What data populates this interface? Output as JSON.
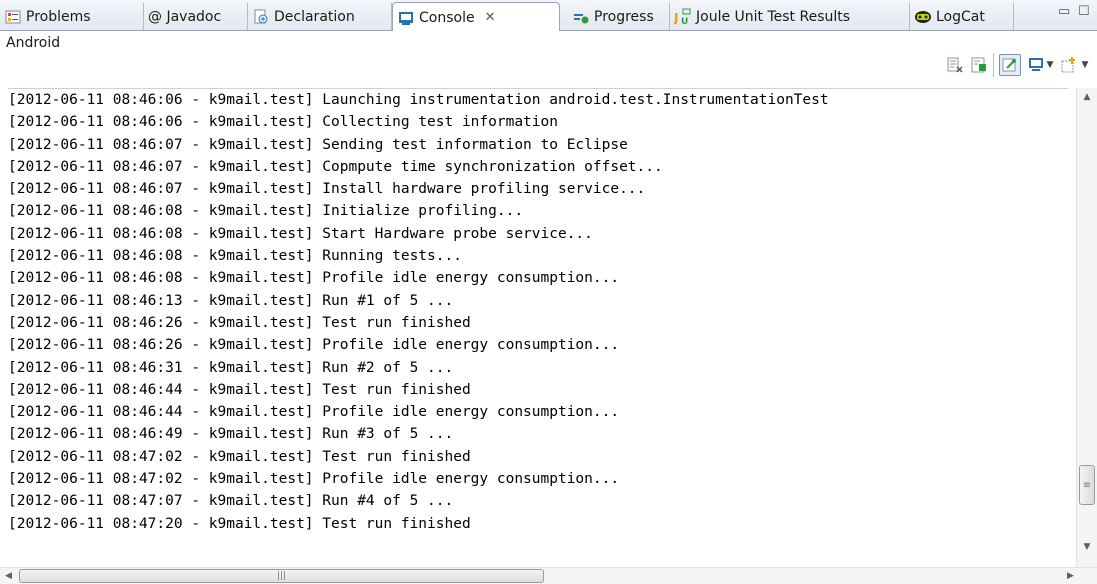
{
  "tabs": [
    {
      "label": "Problems",
      "icon": "problems-icon"
    },
    {
      "label": "@ Javadoc",
      "icon": ""
    },
    {
      "label": "Declaration",
      "icon": "declaration-icon"
    },
    {
      "label": "Console",
      "icon": "console-icon",
      "active": true,
      "close": "✕"
    },
    {
      "label": "Progress",
      "icon": "progress-icon"
    },
    {
      "label": "Joule Unit Test Results",
      "icon": "joule-icon"
    },
    {
      "label": "LogCat",
      "icon": "logcat-icon"
    }
  ],
  "header": {
    "title": "Android"
  },
  "window_controls": {
    "minimize": "▭",
    "maximize": "☐"
  },
  "toolbar": {
    "clear": "clear-console-icon",
    "scroll_lock": "scroll-lock-icon",
    "pin": "pin-console-icon",
    "display": "display-console-icon",
    "open": "open-console-icon"
  },
  "console_lines": [
    "[2012-06-11 08:46:06 - k9mail.test] Launching instrumentation android.test.InstrumentationTest",
    "[2012-06-11 08:46:06 - k9mail.test] Collecting test information",
    "[2012-06-11 08:46:07 - k9mail.test] Sending test information to Eclipse",
    "[2012-06-11 08:46:07 - k9mail.test] Copmpute time synchronization offset...",
    "[2012-06-11 08:46:07 - k9mail.test] Install hardware profiling service...",
    "[2012-06-11 08:46:08 - k9mail.test] Initialize profiling...",
    "[2012-06-11 08:46:08 - k9mail.test] Start Hardware probe service...",
    "[2012-06-11 08:46:08 - k9mail.test] Running tests...",
    "[2012-06-11 08:46:08 - k9mail.test] Profile idle energy consumption...",
    "[2012-06-11 08:46:13 - k9mail.test] Run #1 of 5 ...",
    "[2012-06-11 08:46:26 - k9mail.test] Test run finished",
    "[2012-06-11 08:46:26 - k9mail.test] Profile idle energy consumption...",
    "[2012-06-11 08:46:31 - k9mail.test] Run #2 of 5 ...",
    "[2012-06-11 08:46:44 - k9mail.test] Test run finished",
    "[2012-06-11 08:46:44 - k9mail.test] Profile idle energy consumption...",
    "[2012-06-11 08:46:49 - k9mail.test] Run #3 of 5 ...",
    "[2012-06-11 08:47:02 - k9mail.test] Test run finished",
    "[2012-06-11 08:47:02 - k9mail.test] Profile idle energy consumption...",
    "[2012-06-11 08:47:07 - k9mail.test] Run #4 of 5 ...",
    "[2012-06-11 08:47:20 - k9mail.test] Test run finished"
  ],
  "colors": {
    "accent": "#2b6fb6",
    "tab_bg": "#e3e8f0",
    "border": "#9aa6b8"
  }
}
